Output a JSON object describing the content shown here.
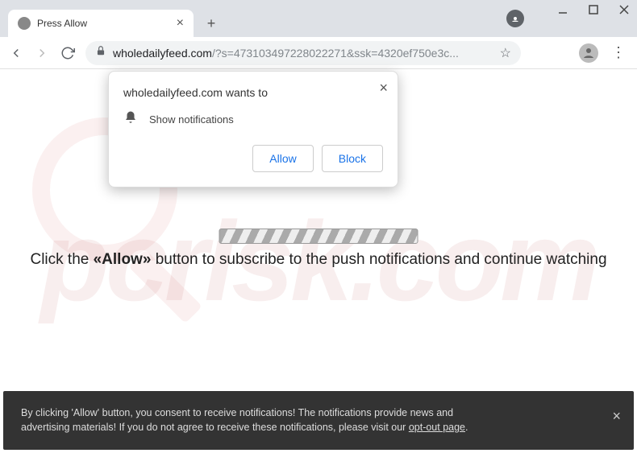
{
  "tab": {
    "title": "Press Allow"
  },
  "url": {
    "host": "wholedailyfeed.com",
    "rest": "/?s=473103497228022271&ssk=4320ef750e3c..."
  },
  "permission": {
    "title": "wholedailyfeed.com wants to",
    "label": "Show notifications",
    "allow": "Allow",
    "block": "Block"
  },
  "page": {
    "message_pre": "Click the ",
    "message_bold": "«Allow»",
    "message_post": " button to subscribe to the push notifications and continue watching"
  },
  "consent": {
    "line1": "By clicking 'Allow' button, you consent to receive notifications! The notifications provide news and",
    "line2_pre": "advertising materials! If you do not agree to receive these notifications, please visit our ",
    "link": "opt-out page",
    "line2_post": "."
  },
  "watermark": "pcrisk.com"
}
